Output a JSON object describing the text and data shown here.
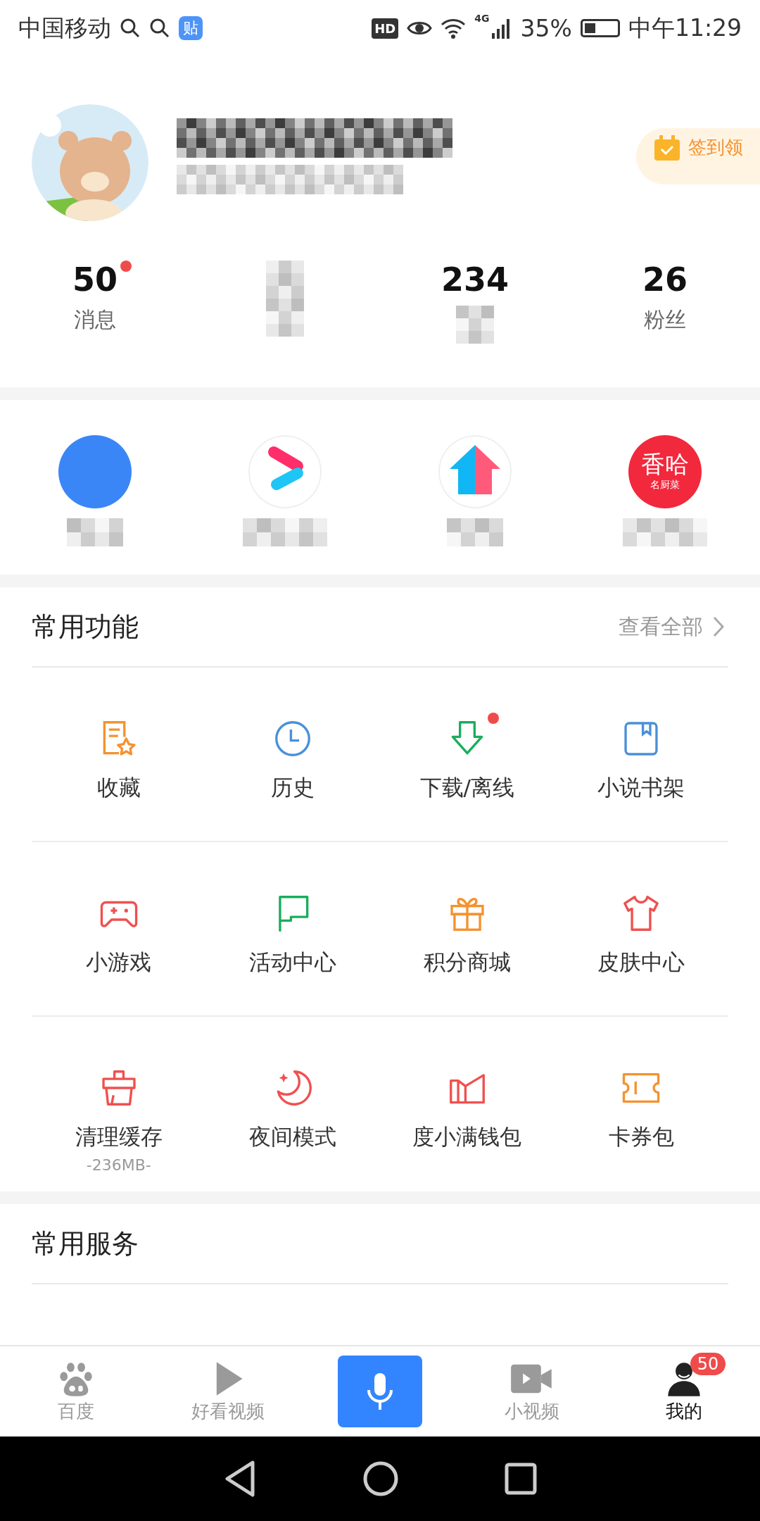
{
  "status_bar": {
    "carrier": "中国移动",
    "app_badge": "贴",
    "hd": "HD",
    "network": "4G",
    "battery": "35%",
    "time": "中午11:29"
  },
  "profile": {
    "sign_in": "签到领"
  },
  "stats": [
    {
      "value": "50",
      "label": "消息",
      "dot": true
    },
    {
      "blurred": true
    },
    {
      "value": "234",
      "dot": false
    },
    {
      "value": "26",
      "label": "粉丝",
      "dot": false
    }
  ],
  "apps": [
    {
      "kind": "blue"
    },
    {
      "kind": "play"
    },
    {
      "kind": "house"
    },
    {
      "kind": "xiangha",
      "title": "香哈",
      "subtitle": "名厨菜"
    }
  ],
  "functions": {
    "title": "常用功能",
    "more": "查看全部",
    "items": [
      {
        "label": "收藏",
        "kind": "doc-star",
        "color": "#f5922f",
        "dot": false
      },
      {
        "label": "历史",
        "kind": "clock",
        "color": "#4a90d9",
        "dot": false
      },
      {
        "label": "下载/离线",
        "kind": "download",
        "color": "#1aad5c",
        "dot": true
      },
      {
        "label": "小说书架",
        "kind": "book",
        "color": "#4a90d9",
        "dot": false
      },
      {
        "label": "小游戏",
        "kind": "gamepad",
        "color": "#f0504f",
        "dot": false
      },
      {
        "label": "活动中心",
        "kind": "flag",
        "color": "#1aad5c",
        "dot": false
      },
      {
        "label": "积分商城",
        "kind": "gift",
        "color": "#f5922f",
        "dot": false
      },
      {
        "label": "皮肤中心",
        "kind": "shirt",
        "color": "#f0504f",
        "dot": false
      },
      {
        "label": "清理缓存",
        "sub": "-236MB-",
        "kind": "basket",
        "color": "#f0504f",
        "dot": false
      },
      {
        "label": "夜间模式",
        "kind": "moon",
        "color": "#f0504f",
        "dot": false
      },
      {
        "label": "度小满钱包",
        "kind": "wallet",
        "color": "#f0504f",
        "dot": false
      },
      {
        "label": "卡券包",
        "kind": "ticket",
        "color": "#f5922f",
        "dot": false
      }
    ]
  },
  "services": {
    "title": "常用服务"
  },
  "bottom_nav": [
    {
      "kind": "paw",
      "label": "百度",
      "selected": false
    },
    {
      "kind": "play",
      "label": "好看视频",
      "selected": false
    },
    {
      "kind": "mic",
      "selected": false
    },
    {
      "kind": "video",
      "label": "小视频",
      "selected": false
    },
    {
      "kind": "person",
      "label": "我的",
      "selected": true,
      "badge": "50"
    }
  ]
}
